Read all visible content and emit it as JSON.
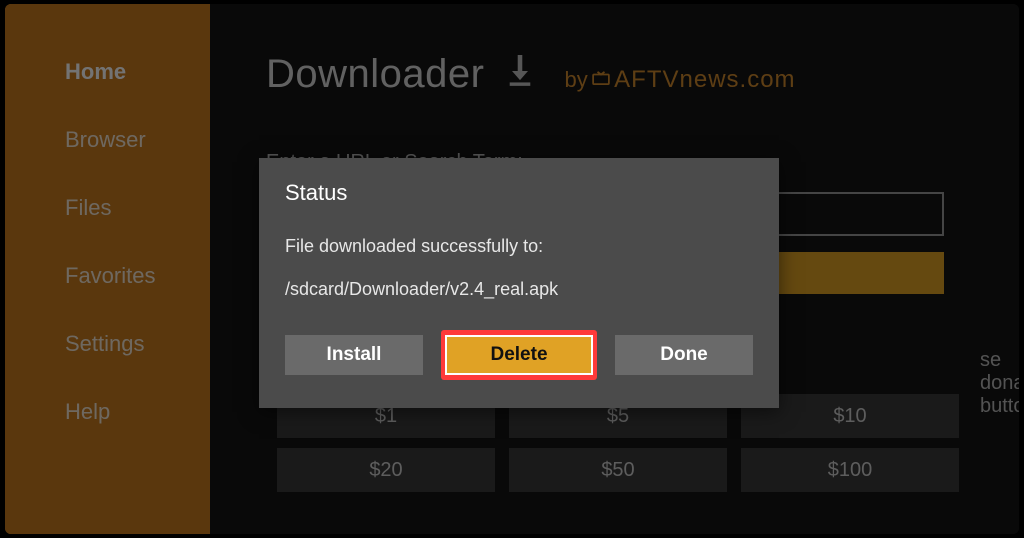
{
  "sidebar": {
    "items": [
      {
        "label": "Home"
      },
      {
        "label": "Browser"
      },
      {
        "label": "Files"
      },
      {
        "label": "Favorites"
      },
      {
        "label": "Settings"
      },
      {
        "label": "Help"
      }
    ]
  },
  "header": {
    "app_title": "Downloader",
    "by_label": "by",
    "brand": "AFTVnews.com"
  },
  "main": {
    "url_prompt": "Enter a URL or Search Term:",
    "donate_label": "se donation buttons:",
    "donations_row1": [
      "$1",
      "$5",
      "$10"
    ],
    "donations_row2": [
      "$20",
      "$50",
      "$100"
    ]
  },
  "modal": {
    "title": "Status",
    "message": "File downloaded successfully to:",
    "path": "/sdcard/Downloader/v2.4_real.apk",
    "install_label": "Install",
    "delete_label": "Delete",
    "done_label": "Done"
  }
}
